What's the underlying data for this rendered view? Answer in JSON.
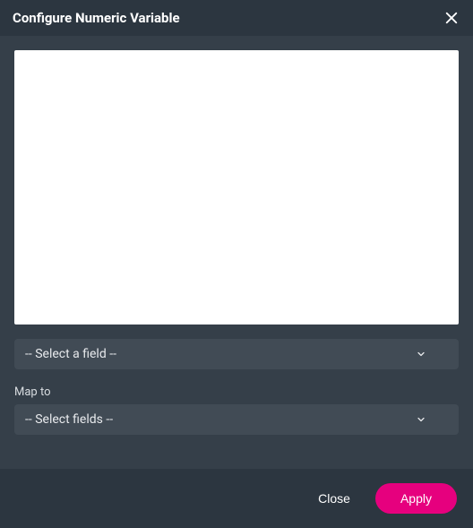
{
  "header": {
    "title": "Configure Numeric Variable"
  },
  "field_select": {
    "placeholder": "-- Select a field --"
  },
  "map_to": {
    "label": "Map to",
    "placeholder": "-- Select fields --"
  },
  "footer": {
    "close_label": "Close",
    "apply_label": "Apply"
  }
}
